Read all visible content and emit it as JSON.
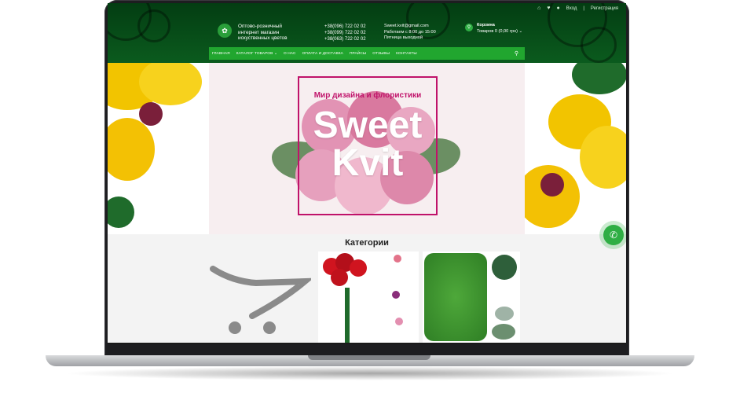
{
  "topbar": {
    "login": "Вход",
    "separator": "|",
    "register": "Регистрация"
  },
  "brand": {
    "line1": "Оптово-розничный",
    "line2": "интернет магазин",
    "line3": "искуственных цветов"
  },
  "phones": [
    "+38(096) 722 02 02",
    "+38(099) 722 02 02",
    "+38(063) 722 02 02"
  ],
  "contact": {
    "email": "Sweet.kvit@gmail.com",
    "hours": "Работаем с 8:00 до 15:00",
    "dayoff": "Пятница выходной"
  },
  "cart": {
    "title": "Корзина",
    "summary": "Товаров 0 (0,00 грн)",
    "caret": "⌄"
  },
  "nav": {
    "items": [
      "ГЛАВНАЯ",
      "КАТАЛОГ ТОВАРОВ ⌄",
      "О НАС",
      "ОПЛАТА И ДОСТАВКА",
      "ПРАЙСЫ",
      "ОТЗЫВЫ",
      "КОНТАКТЫ"
    ]
  },
  "banner": {
    "subtitle": "Мир дизайна и флористики",
    "word1": "Sweet",
    "word2": "Kvit"
  },
  "categories": {
    "title": "Категории"
  },
  "icons": {
    "home": "home-icon",
    "heart": "heart-icon",
    "user": "user-icon",
    "search": "search-icon",
    "cart": "cart-icon",
    "phone": "phone-icon"
  },
  "colors": {
    "header_dark": "#033d12",
    "nav_green": "#21a62f",
    "accent_pink": "#c0126a",
    "frame": "#1d1d20"
  }
}
